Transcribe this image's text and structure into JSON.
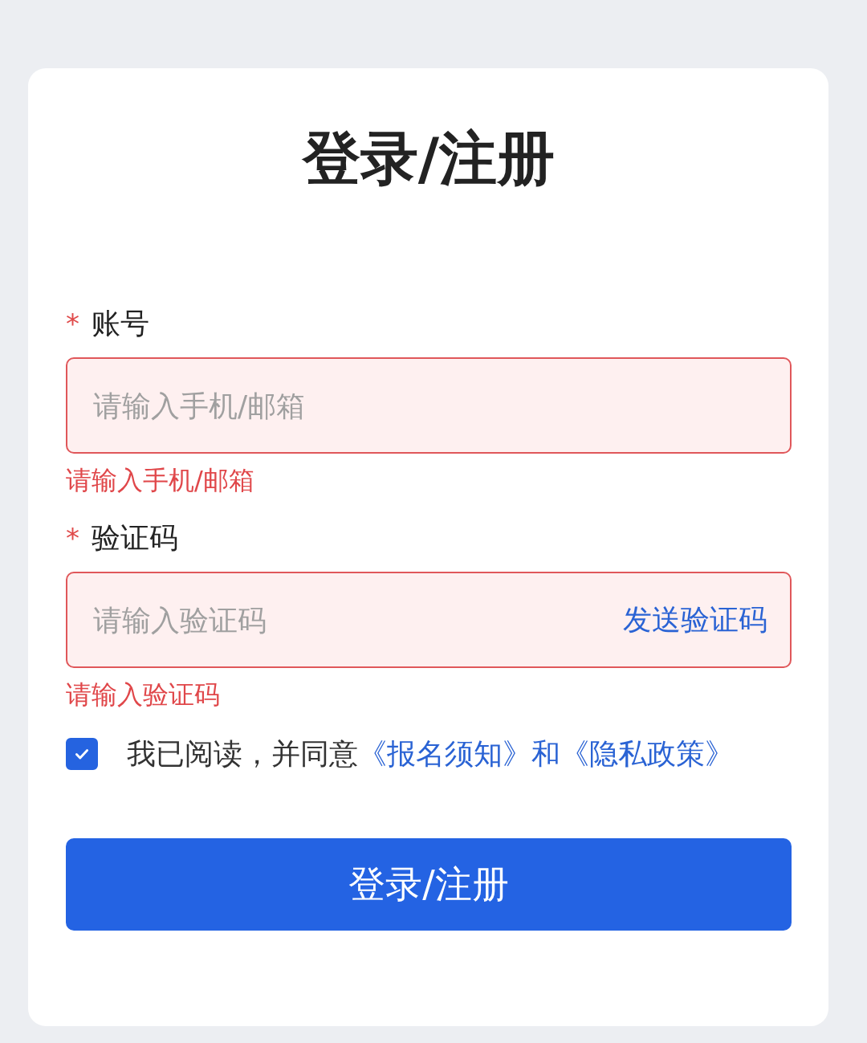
{
  "title": "登录/注册",
  "fields": [
    {
      "label": "账号",
      "required": true,
      "required_mark": "*",
      "placeholder": "请输入手机/邮箱",
      "invalid": true,
      "error": "请输入手机/邮箱"
    },
    {
      "label": "验证码",
      "required": true,
      "required_mark": "*",
      "placeholder": "请输入验证码",
      "action": "发送验证码",
      "invalid": true,
      "error": "请输入验证码"
    }
  ],
  "agreement": {
    "checked": true,
    "parts": [
      {
        "kind": "text",
        "text": "我已阅读，并同意"
      },
      {
        "kind": "link",
        "text": "《报名须知》"
      },
      {
        "kind": "conjunction",
        "text": "和"
      },
      {
        "kind": "link",
        "text": "《隐私政策》"
      }
    ]
  },
  "submit": "登录/注册"
}
